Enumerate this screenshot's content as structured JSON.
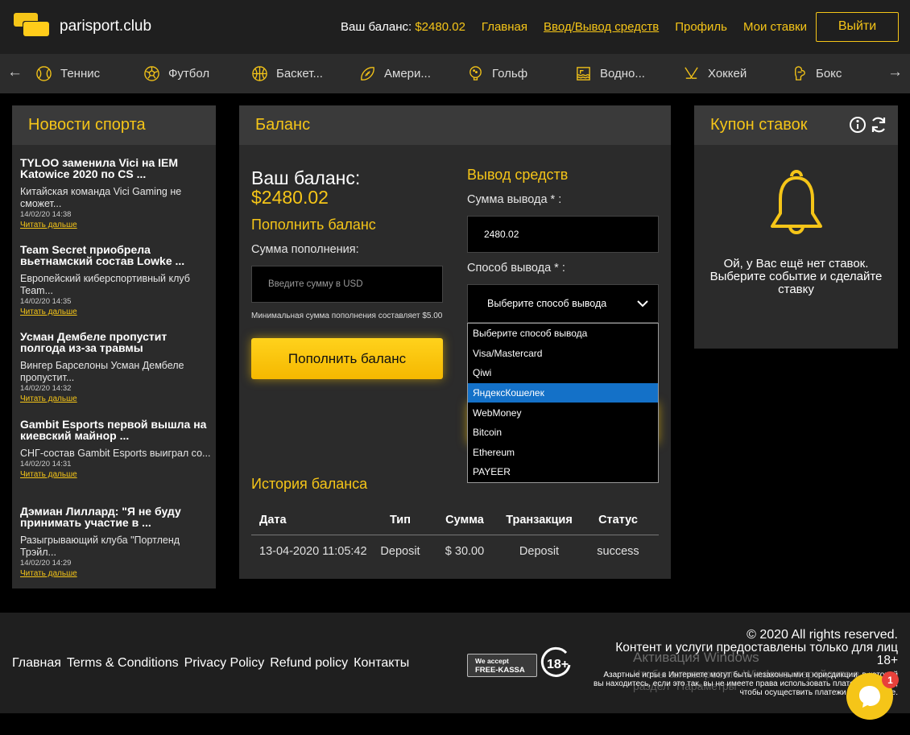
{
  "header": {
    "site_name": "parisport.club",
    "balance_label": "Ваш баланс:",
    "balance_value": "$2480.02",
    "nav": [
      "Главная",
      "Ввод/Вывод средств",
      "Профиль",
      "Мои ставки"
    ],
    "logout": "Выйти"
  },
  "sports": [
    "Теннис",
    "Футбол",
    "Баскет...",
    "Амери...",
    "Гольф",
    "Водно...",
    "Хоккей",
    "Бокс"
  ],
  "news": {
    "title": "Новости спорта",
    "items": [
      {
        "title": "TYLOO заменила Vici на IEM Katowice 2020 по CS ...",
        "text": "Китайская команда Vici Gaming не сможет...",
        "date": "14/02/20 14:38",
        "more": "Читать дальше"
      },
      {
        "title": "Team Secret приобрела вьетнамский состав Lowke ...",
        "text": "Европейский киберспортивный клуб Team...",
        "date": "14/02/20 14:35",
        "more": "Читать дальше"
      },
      {
        "title": "Усман Дембеле пропустит полгода из-за травмы",
        "text": "Вингер Барселоны Усман Дембеле пропустит...",
        "date": "14/02/20 14:32",
        "more": "Читать дальше"
      },
      {
        "title": "Gambit Esports первой вышла на киевский майнор ...",
        "text": "СНГ-состав Gambit Esports выиграл со...",
        "date": "14/02/20 14:31",
        "more": "Читать дальше"
      },
      {
        "title": "Дэмиан Лиллард: \"Я не буду принимать участие в ...",
        "text": "Разыгрывающий клуба \"Портленд Трэйл...",
        "date": "14/02/20 14:29",
        "more": "Читать дальше"
      }
    ]
  },
  "balance": {
    "title": "Баланс",
    "your_balance_label": "Ваш баланс:",
    "your_balance_value": "$2480.02",
    "deposit_title": "Пополнить баланс",
    "deposit_amount_label": "Сумма пополнения:",
    "deposit_placeholder": "Введите сумму в USD",
    "min_note": "Минимальная сумма пополнения составляет $5.00",
    "deposit_button": "Пополнить баланс",
    "withdraw_title": "Вывод средств",
    "withdraw_amount_label": "Сумма вывода * :",
    "withdraw_amount_value": "2480.02",
    "withdraw_method_label": "Способ вывода * :",
    "withdraw_method_selected": "Выберите способ вывода",
    "withdraw_options": [
      "Выберите способ вывода",
      "Visa/Mastercard",
      "Qiwi",
      "ЯндексКошелек",
      "WebMoney",
      "Bitcoin",
      "Ethereum",
      "PAYEER"
    ],
    "withdraw_highlighted": "ЯндексКошелек",
    "history_title": "История баланса",
    "history_headers": [
      "Дата",
      "Тип",
      "Сумма",
      "Транзакция",
      "Статус"
    ],
    "history_rows": [
      [
        "13-04-2020 11:05:42",
        "Deposit",
        "$ 30.00",
        "Deposit",
        "success"
      ]
    ]
  },
  "coupon": {
    "title": "Купон ставок",
    "empty_message": "Ой, у Вас ещё нет ставок. Выберите событие и сделайте ставку"
  },
  "footer": {
    "nav": [
      "Главная",
      "Terms & Conditions",
      "Privacy Policy",
      "Refund policy",
      "Контакты"
    ],
    "badge_line1": "We accept",
    "badge_line2": "FREE-KASSA",
    "age": "18+",
    "copyright": "© 2020 All rights reserved.",
    "provided": "Контент и услуги предоставлены только для лиц 18+",
    "legal": "Азартные игры в Интернете могут быть незаконными в юрисдикции, в которой вы находитесь, если это так, вы не имеете права использовать платежную карту, чтобы осуществить платежи в этом сайте.",
    "windows_title": "Активация Windows",
    "windows_text": "Чтобы активировать Windows, перейдите в раздел \"Параметры\".",
    "chat_badge": "1"
  },
  "colors": {
    "accent": "#f5c518",
    "panel": "#2b2b2b",
    "panel_head": "#3a3a3a",
    "highlight": "#1471c8"
  }
}
